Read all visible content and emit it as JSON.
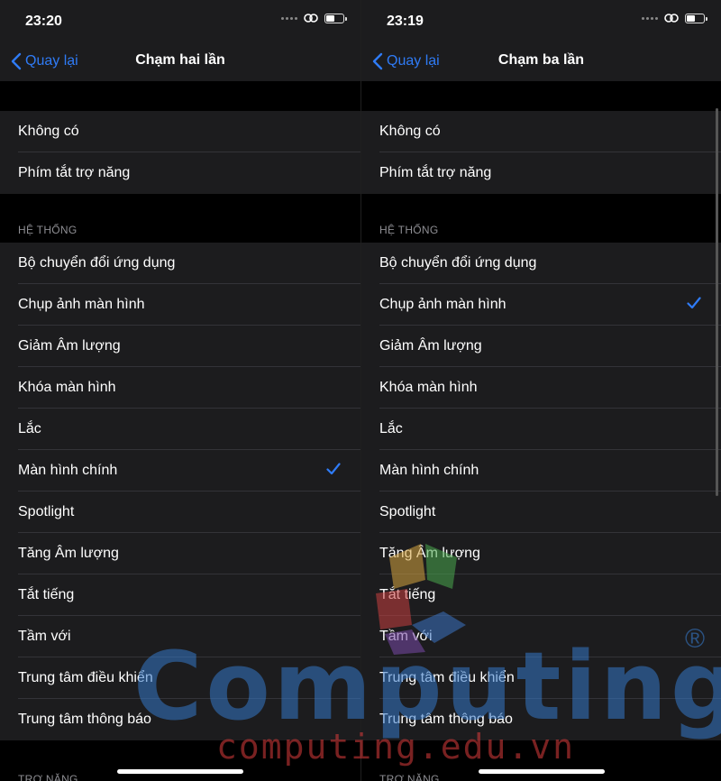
{
  "left": {
    "status": {
      "time": "23:20"
    },
    "nav": {
      "back_label": "Quay lại",
      "title": "Chạm hai lần"
    },
    "options_top": [
      "Không có",
      "Phím tắt trợ năng"
    ],
    "system_header": "HỆ THỐNG",
    "system_items": [
      "Bộ chuyển đổi ứng dụng",
      "Chụp ảnh màn hình",
      "Giảm Âm lượng",
      "Khóa màn hình",
      "Lắc",
      "Màn hình chính",
      "Spotlight",
      "Tăng Âm lượng",
      "Tắt tiếng",
      "Tầm với",
      "Trung tâm điều khiển",
      "Trung tâm thông báo"
    ],
    "selected": "Màn hình chính",
    "next_header": "TRỢ NĂNG"
  },
  "right": {
    "status": {
      "time": "23:19"
    },
    "nav": {
      "back_label": "Quay lại",
      "title": "Chạm ba lần"
    },
    "options_top": [
      "Không có",
      "Phím tắt trợ năng"
    ],
    "system_header": "HỆ THỐNG",
    "system_items": [
      "Bộ chuyển đổi ứng dụng",
      "Chụp ảnh màn hình",
      "Giảm Âm lượng",
      "Khóa màn hình",
      "Lắc",
      "Màn hình chính",
      "Spotlight",
      "Tăng Âm lượng",
      "Tắt tiếng",
      "Tầm với",
      "Trung tâm điều khiển",
      "Trung tâm thông báo"
    ],
    "selected": "Chụp ảnh màn hình",
    "next_header": "TRỢ NĂNG"
  },
  "watermark": {
    "brand": "Computing",
    "url": "computing.edu.vn",
    "reg": "®"
  },
  "colors": {
    "accent": "#2f7bf6",
    "background": "#000000",
    "cell": "#1c1c1e",
    "separator": "#333338",
    "secondary_text": "#8e8e93"
  }
}
